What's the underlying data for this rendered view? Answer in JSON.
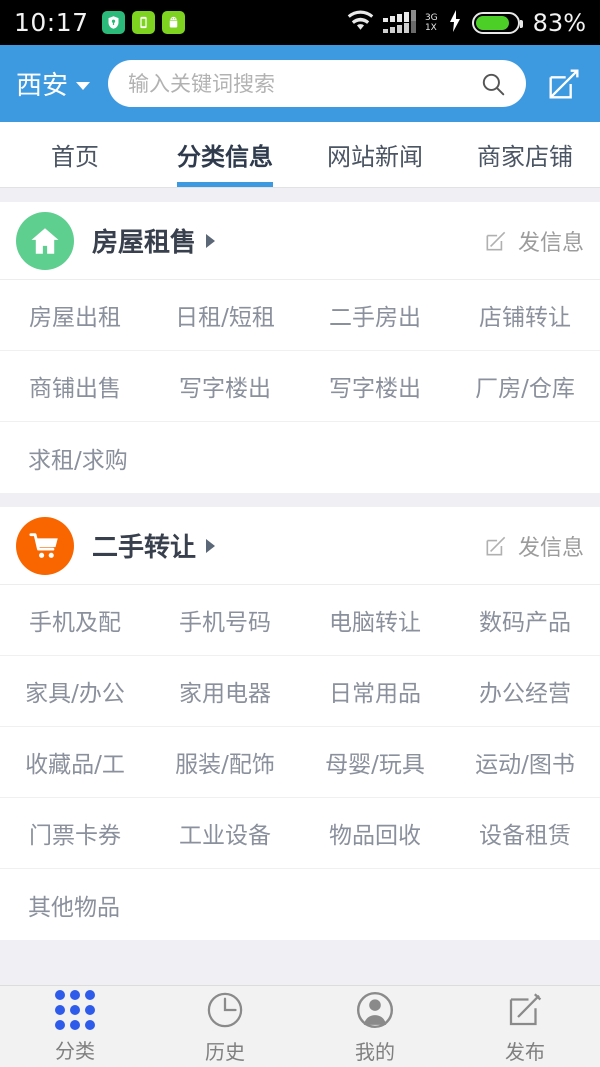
{
  "statusbar": {
    "time": "10:17",
    "battery_percent": "83%",
    "network_type": "3G",
    "network_sub": "1X",
    "icons": [
      "shield-icon",
      "battery-saver-icon",
      "android-robot-icon",
      "wifi-icon",
      "signal-icon",
      "charging-bolt-icon",
      "battery-icon"
    ]
  },
  "header": {
    "city": "西安",
    "search_placeholder": "输入关键词搜索",
    "search_value": "",
    "compose_icon": "compose-icon",
    "accent_color": "#3d9ae0"
  },
  "tabs": [
    {
      "label": "首页",
      "active": false
    },
    {
      "label": "分类信息",
      "active": true
    },
    {
      "label": "网站新闻",
      "active": false
    },
    {
      "label": "商家店铺",
      "active": false
    }
  ],
  "sections": [
    {
      "title": "房屋租售",
      "icon": "house-icon",
      "icon_color": "#5ecf8f",
      "post_label": "发信息",
      "items": [
        "房屋出租",
        "日租/短租",
        "二手房出",
        "店铺转让",
        "商铺出售",
        "写字楼出",
        "写字楼出",
        "厂房/仓库",
        "求租/求购"
      ]
    },
    {
      "title": "二手转让",
      "icon": "shopping-cart-icon",
      "icon_color": "#f96600",
      "post_label": "发信息",
      "items": [
        "手机及配",
        "手机号码",
        "电脑转让",
        "数码产品",
        "家具/办公",
        "家用电器",
        "日常用品",
        "办公经营",
        "收藏品/工",
        "服装/配饰",
        "母婴/玩具",
        "运动/图书",
        "门票卡券",
        "工业设备",
        "物品回收",
        "设备租赁",
        "其他物品"
      ]
    }
  ],
  "bottom_nav": [
    {
      "label": "分类",
      "icon": "grid-dots-icon",
      "active": true
    },
    {
      "label": "历史",
      "icon": "clock-icon",
      "active": false
    },
    {
      "label": "我的",
      "icon": "person-icon",
      "active": false
    },
    {
      "label": "发布",
      "icon": "compose-icon",
      "active": false
    }
  ]
}
